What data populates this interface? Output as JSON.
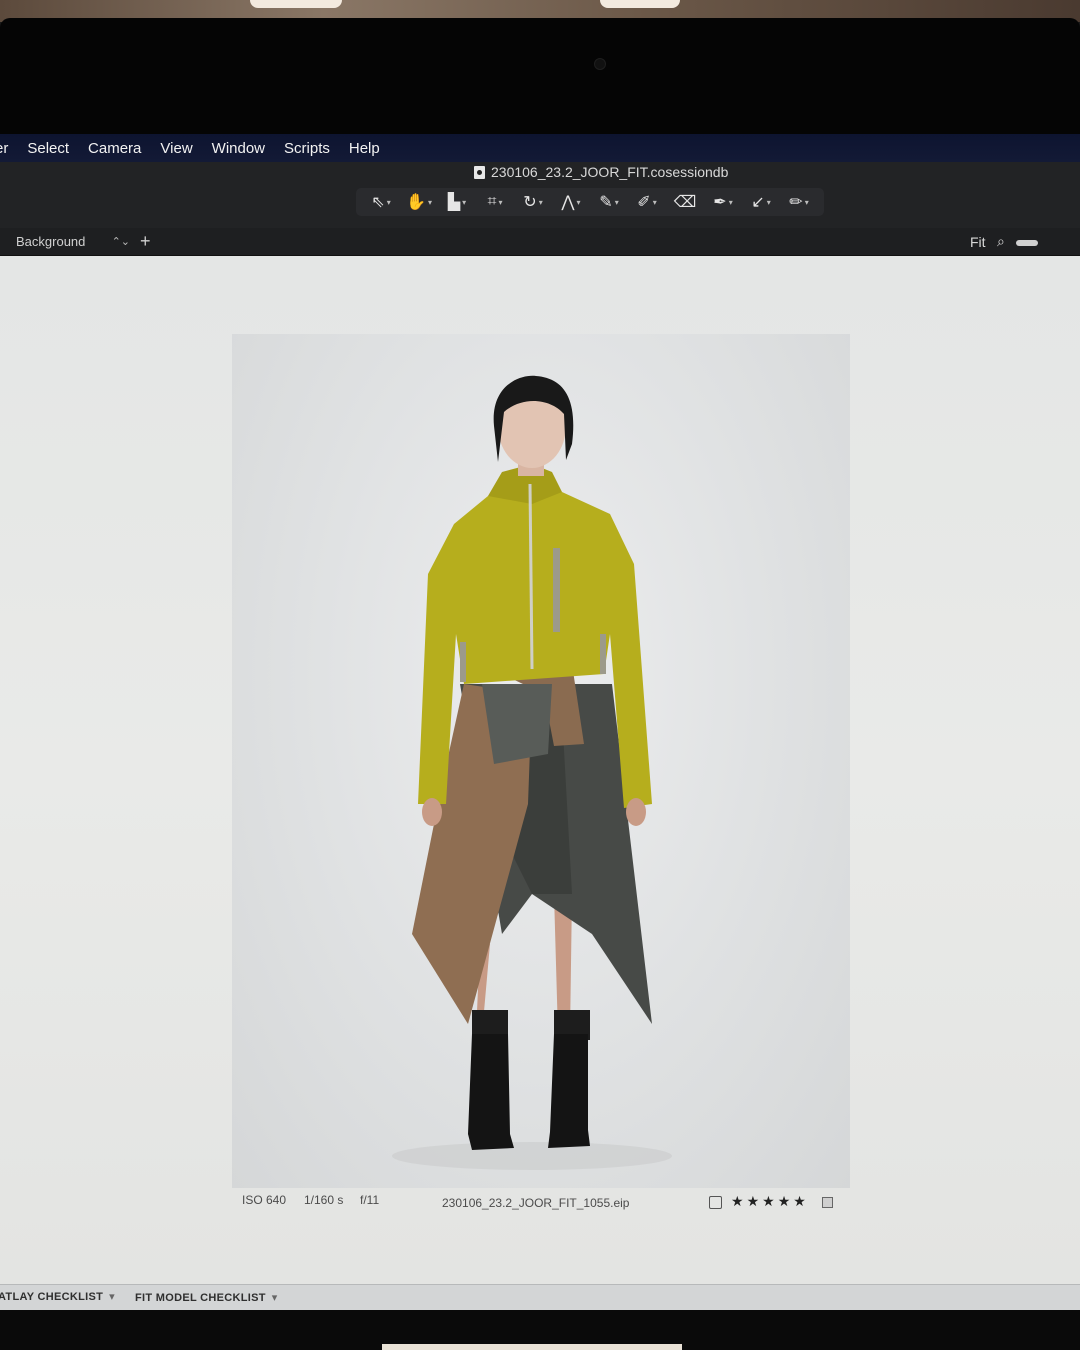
{
  "menubar": {
    "items": [
      "rer",
      "Select",
      "Camera",
      "View",
      "Window",
      "Scripts",
      "Help"
    ]
  },
  "window": {
    "title": "230106_23.2_JOOR_FIT.cosessiondb"
  },
  "toolbar": {
    "tools": [
      {
        "name": "select-icon",
        "glyph": "⇖"
      },
      {
        "name": "pan-hand-icon",
        "glyph": "✋"
      },
      {
        "name": "loupe-icon",
        "glyph": "▙"
      },
      {
        "name": "crop-icon",
        "glyph": "⌗"
      },
      {
        "name": "rotate-icon",
        "glyph": "↻"
      },
      {
        "name": "keystone-icon",
        "glyph": "⋀"
      },
      {
        "name": "picker-icon",
        "glyph": "✎"
      },
      {
        "name": "brush-icon",
        "glyph": "✐"
      },
      {
        "name": "eraser-icon",
        "glyph": "⌫"
      },
      {
        "name": "pen-icon",
        "glyph": "✒"
      },
      {
        "name": "arrow-icon",
        "glyph": "↙"
      },
      {
        "name": "pencil-icon",
        "glyph": "✏"
      }
    ]
  },
  "variantbar": {
    "layer": "Background",
    "add": "+",
    "zoom": "Fit"
  },
  "image": {
    "iso": "ISO 640",
    "shutter": "1/160 s",
    "aperture": "f/11",
    "filename": "230106_23.2_JOOR_FIT_1055.eip",
    "star_glyph": "★",
    "rating": 5
  },
  "bottom_tabs": [
    "ATLAY CHECKLIST",
    "FIT MODEL CHECKLIST"
  ],
  "colors": {
    "menubar": "#131a36",
    "jacket": "#b6ae1d",
    "skirt_tweed": "#8f6e52",
    "skirt_plaid": "#4a4d4a",
    "viewer_bg": "#e6e7e5"
  }
}
